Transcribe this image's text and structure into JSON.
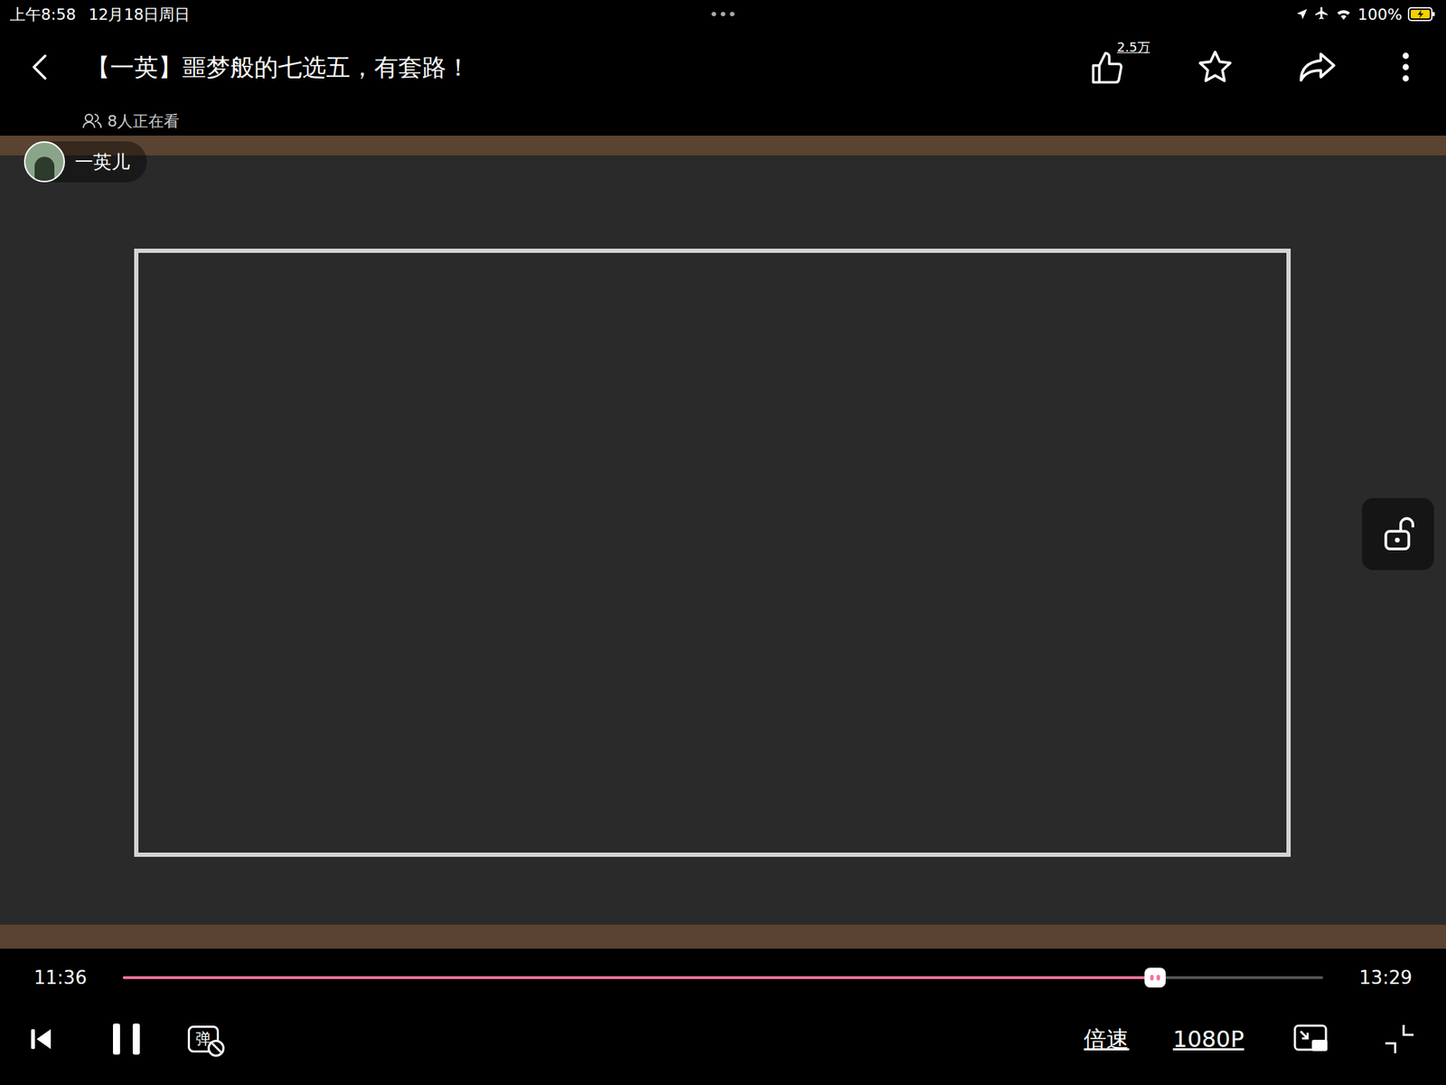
{
  "status_bar": {
    "time": "上午8:58",
    "date": "12月18日周日",
    "dots": "•••",
    "battery": "100%"
  },
  "header": {
    "title": "【一英】噩梦般的七选五，有套路！",
    "like_count": "2.5万",
    "viewers": "8人正在看"
  },
  "uploader": {
    "name": "一英儿"
  },
  "player": {
    "current": "11:36",
    "duration": "13:29",
    "progress": 0.86,
    "playing": true,
    "danmaku_icon": "弹",
    "danmaku_enabled": false,
    "speed": "倍速",
    "quality": "1080P",
    "locked": false
  }
}
